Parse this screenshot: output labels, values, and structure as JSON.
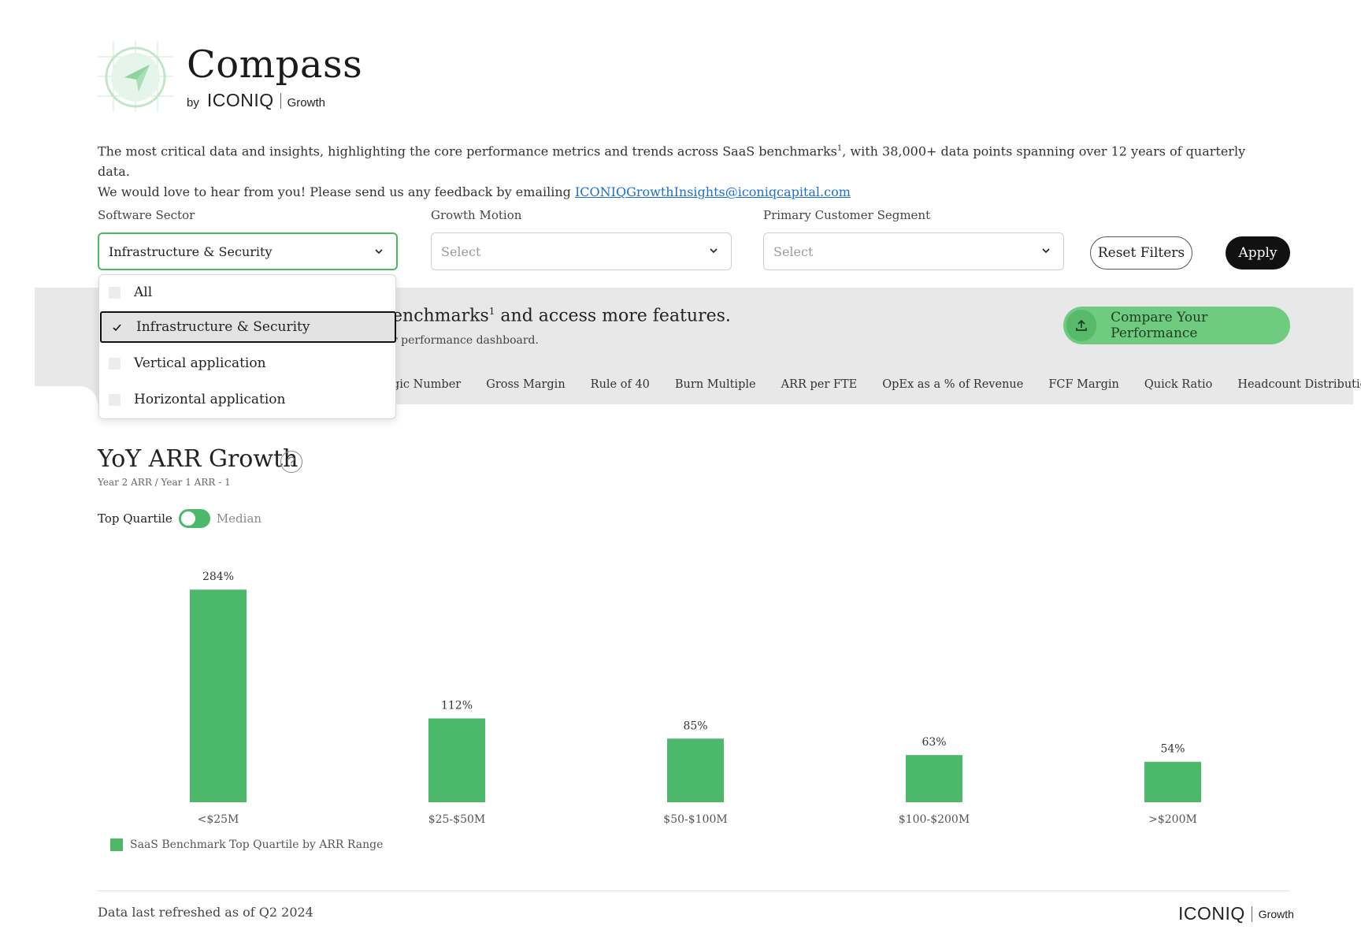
{
  "brand": {
    "title": "Compass",
    "by": "by",
    "company": "ICONIQ",
    "growth": "Growth"
  },
  "intro": {
    "line1_a": "The most critical data and insights, highlighting the core performance metrics and trends across SaaS benchmarks",
    "line1_sup": "1",
    "line1_b": ", with 38,000+ data points spanning over 12 years of quarterly data.",
    "line2_a": "We would love to hear from you! Please send us any feedback by emailing ",
    "email": "ICONIQGrowthInsights@iconiqcapital.com"
  },
  "filters": {
    "software_sector": {
      "label": "Software Sector",
      "value": "Infrastructure & Security"
    },
    "growth_motion": {
      "label": "Growth Motion",
      "placeholder": "Select"
    },
    "customer_segment": {
      "label": "Primary Customer Segment",
      "placeholder": "Select"
    },
    "reset_label": "Reset Filters",
    "apply_label": "Apply"
  },
  "dropdown": {
    "options": [
      {
        "label": "All",
        "checked": false
      },
      {
        "label": "Infrastructure & Security",
        "checked": true
      },
      {
        "label": "Vertical application",
        "checked": false
      },
      {
        "label": "Horizontal application",
        "checked": false
      }
    ]
  },
  "promo": {
    "title_a": "enchmarks",
    "title_sup": "1",
    "title_b": " and access more features.",
    "subtitle": "r performance dashboard.",
    "compare_label": "Compare Your Performance"
  },
  "tabs": [
    "gic Number",
    "Gross Margin",
    "Rule of 40",
    "Burn Multiple",
    "ARR per FTE",
    "OpEx as a % of Revenue",
    "FCF Margin",
    "Quick Ratio",
    "Headcount Distribution"
  ],
  "chart_section": {
    "title": "YoY ARR Growth",
    "subtitle": "Year 2 ARR / Year 1 ARR - 1",
    "toggle_left": "Top Quartile",
    "toggle_right": "Median",
    "help": "?"
  },
  "chart_data": {
    "type": "bar",
    "categories": [
      "<$25M",
      "$25-$50M",
      "$50-$100M",
      "$100-$200M",
      ">$200M"
    ],
    "values": [
      284,
      112,
      85,
      63,
      54
    ],
    "data_labels": [
      "284%",
      "112%",
      "85%",
      "63%",
      "54%"
    ],
    "series": [
      {
        "name": "SaaS Benchmark Top Quartile by ARR Range",
        "values": [
          284,
          112,
          85,
          63,
          54
        ]
      }
    ],
    "unit": "%",
    "bar_color": "#4cb86a",
    "grid": false,
    "legend_position": "bottom-left"
  },
  "legend": {
    "label": "SaaS Benchmark Top Quartile by ARR Range"
  },
  "footer": {
    "refreshed": "Data last refreshed as of Q2 2024",
    "company": "ICONIQ",
    "growth": "Growth"
  },
  "colors": {
    "accent": "#4cb86a",
    "compare_button": "#6ecb7f",
    "apply_button": "#111111",
    "band": "#e8e8e8",
    "link": "#1a6fd0"
  },
  "icons": {
    "logo": "compass-logo-icon",
    "chevron": "chevron-down-icon",
    "upload": "upload-icon",
    "check": "check-icon",
    "help": "help-icon"
  }
}
